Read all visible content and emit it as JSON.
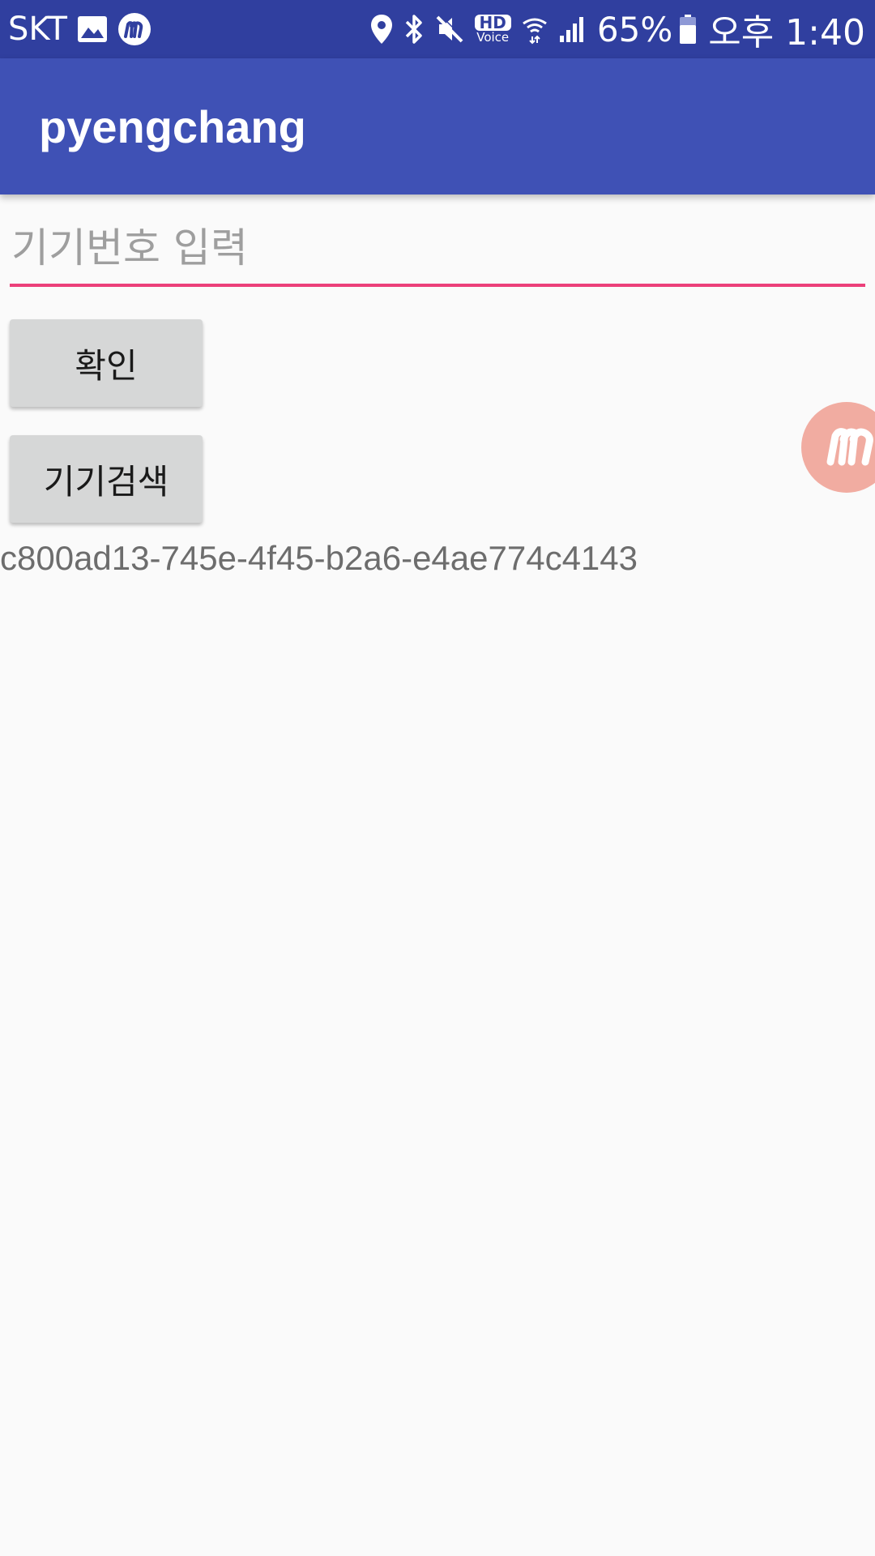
{
  "status_bar": {
    "carrier": "SKT",
    "battery_percent": "65%",
    "time": "오후 1:40",
    "hd_voice_top": "HD",
    "hd_voice_bottom": "Voice",
    "icons": [
      "image-icon",
      "mobizen-icon",
      "location-icon",
      "bluetooth-icon",
      "mute-icon",
      "hd-voice-icon",
      "wifi-icon",
      "signal-icon",
      "battery-icon"
    ]
  },
  "app_bar": {
    "title": "pyengchang",
    "color": "#3f51b5"
  },
  "device_input": {
    "value": "",
    "placeholder": "기기번호 입력",
    "accent_color": "#ec407a"
  },
  "buttons": {
    "confirm_label": "확인",
    "search_label": "기기검색"
  },
  "device_id": "c800ad13-745e-4f45-b2a6-e4ae774c4143",
  "floating_bubble": {
    "icon": "mobizen-icon",
    "color": "#f1aca1"
  }
}
